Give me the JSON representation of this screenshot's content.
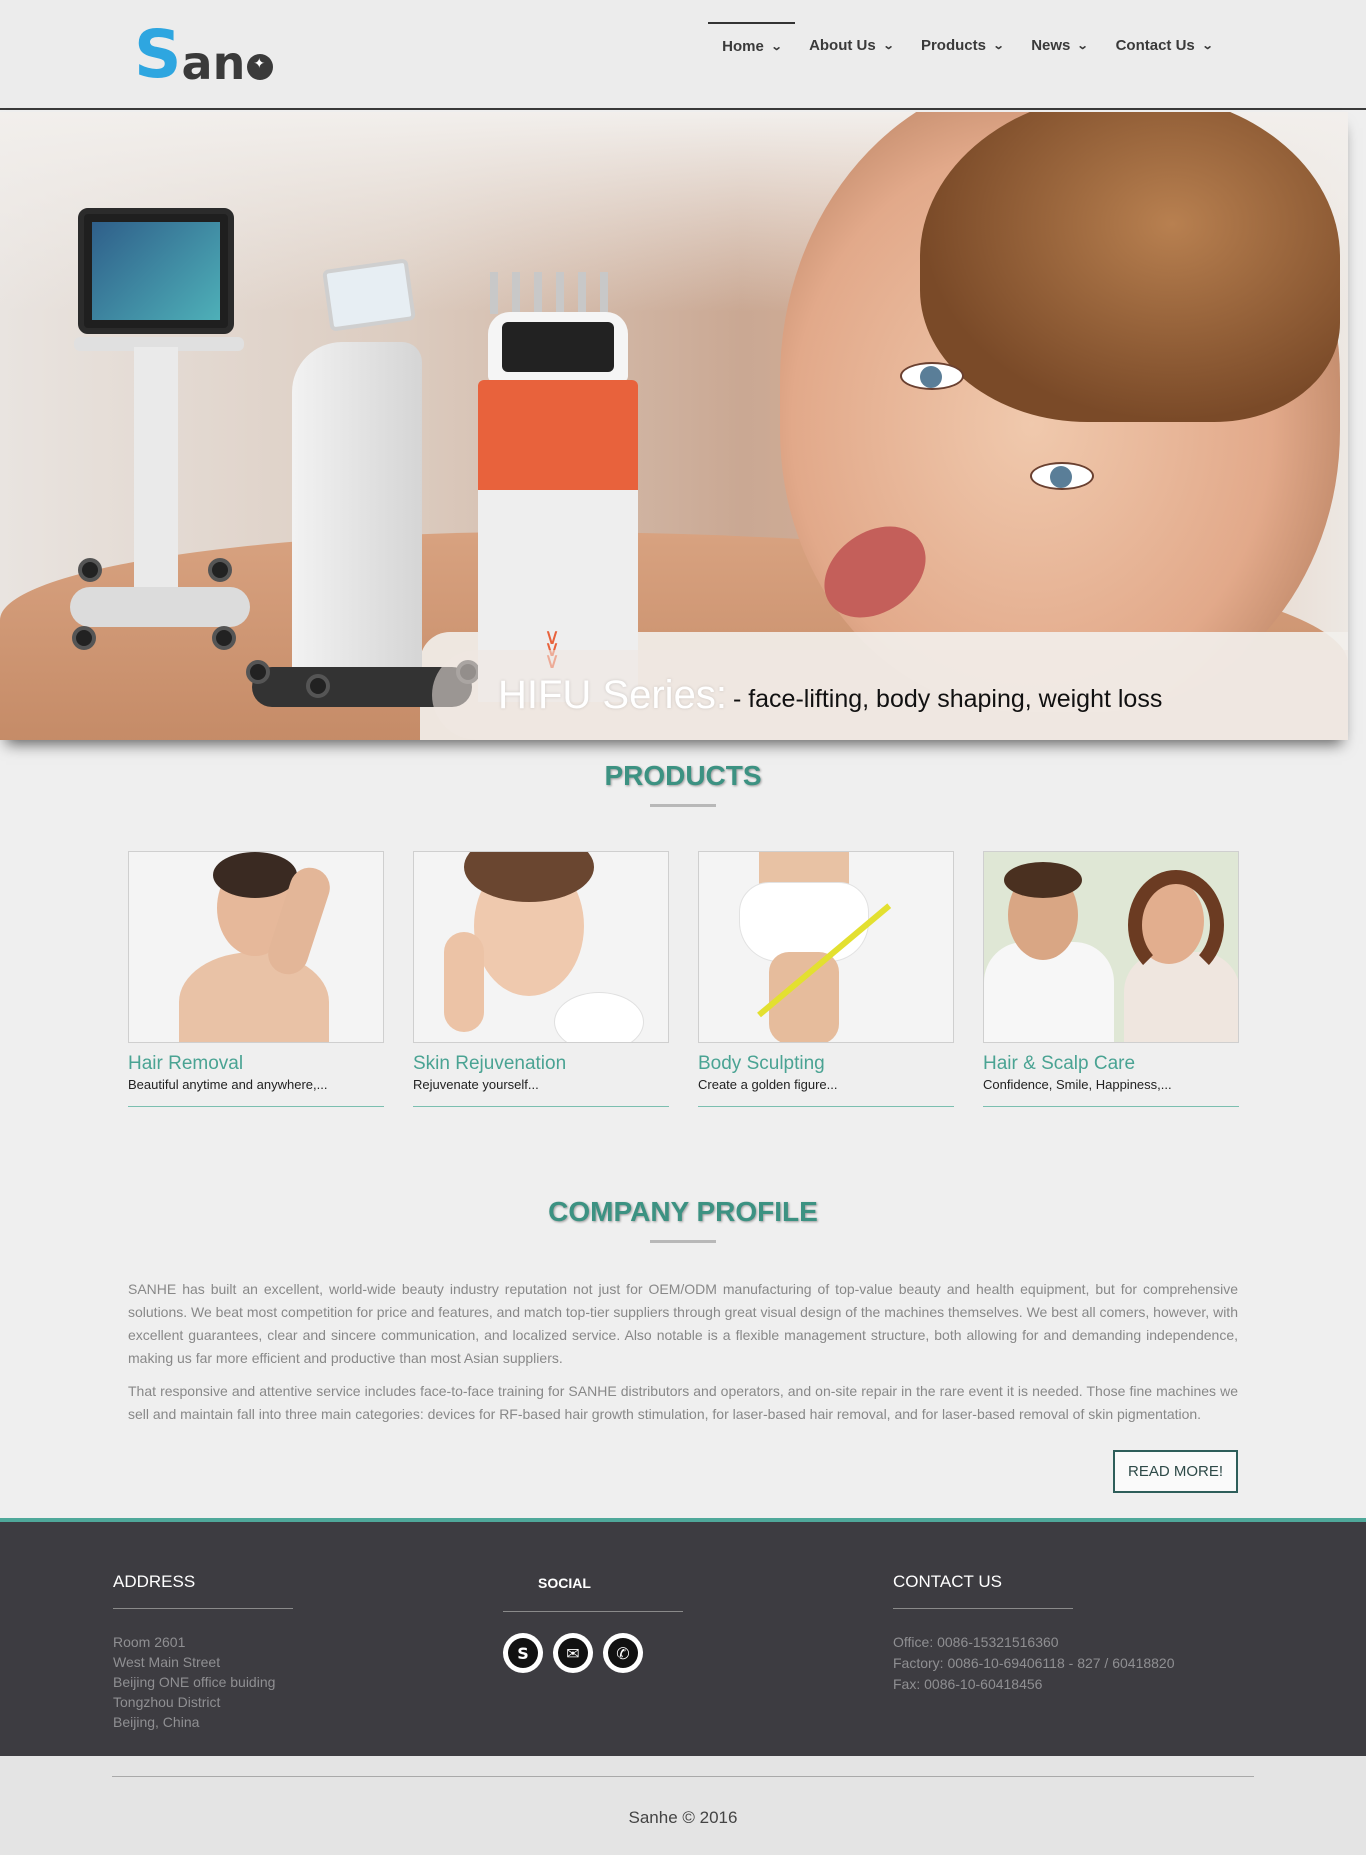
{
  "brand": {
    "logo_s": "S",
    "logo_rest": "an"
  },
  "nav": [
    {
      "label": "Home"
    },
    {
      "label": "About Us"
    },
    {
      "label": "Products"
    },
    {
      "label": "News"
    },
    {
      "label": "Contact Us"
    }
  ],
  "hero": {
    "title": "HIFU Series:",
    "subtitle": "- face-lifting, body shaping, weight loss"
  },
  "products_section": {
    "title": "PRODUCTS",
    "items": [
      {
        "title": "Hair Removal",
        "desc": "Beautiful anytime and anywhere,..."
      },
      {
        "title": "Skin Rejuvenation",
        "desc": "Rejuvenate yourself..."
      },
      {
        "title": "Body Sculpting",
        "desc": "Create a golden figure..."
      },
      {
        "title": "Hair & Scalp Care",
        "desc": "Confidence, Smile, Happiness,..."
      }
    ]
  },
  "profile": {
    "title": "COMPANY PROFILE",
    "p1": "SANHE has built an excellent, world-wide beauty industry reputation not just for OEM/ODM manufacturing of top-value beauty and health equipment, but for comprehensive solutions. We beat most competition for price and features, and match top-tier suppliers through great visual design of the machines themselves. We best all comers, however, with excellent guarantees, clear and sincere communication, and localized service. Also notable is a flexible management structure, both allowing for and demanding independence, making us far more efficient and productive than most Asian suppliers.",
    "p2": "That responsive and attentive service includes face-to-face training for SANHE distributors and operators, and on-site repair in the rare event it is needed. Those fine machines we sell and maintain fall into three main categories: devices for RF-based hair growth stimulation, for laser-based hair removal, and for laser-based removal of skin pigmentation.",
    "read_more": "READ MORE!"
  },
  "footer": {
    "address_title": "ADDRESS",
    "address_lines": [
      "Room 2601",
      "West Main Street",
      "Beijing ONE office buiding",
      "Tongzhou District",
      "Beijing, China"
    ],
    "social_title": "SOCIAL",
    "social": [
      {
        "icon": "skype-icon",
        "glyph": "S"
      },
      {
        "icon": "mail-icon",
        "glyph": "✉"
      },
      {
        "icon": "whatsapp-icon",
        "glyph": "✆"
      }
    ],
    "contact_title": "CONTACT US",
    "contact_lines": [
      "Office: 0086-15321516360",
      "Factory: 0086-10-69406118 - 827 / 60418820",
      "Fax: 0086-10-60418456"
    ],
    "copyright": "Sanhe © 2016"
  },
  "colors": {
    "accent": "#3c9282",
    "footer_bg": "#3d3c41",
    "logo_blue": "#2ea6e0"
  }
}
